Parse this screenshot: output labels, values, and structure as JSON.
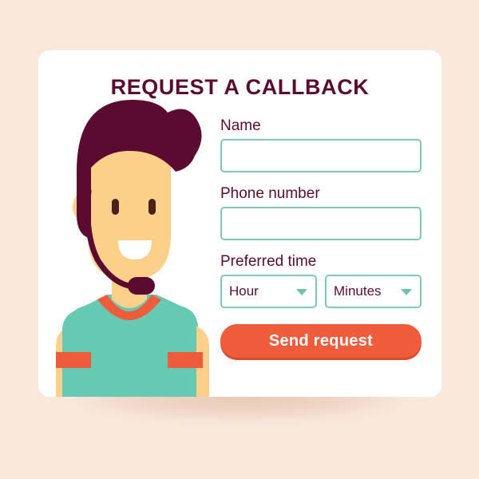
{
  "theme": {
    "background": "#FAE8DD",
    "card": "#FFFFFF",
    "accent_maroon": "#5C0B30",
    "accent_mint": "#7CCAB4",
    "accent_orange": "#EF5C3C",
    "skin": "#FAD08A",
    "shirt": "#66C9B1"
  },
  "card": {
    "title": "REQUEST A CALLBACK"
  },
  "form": {
    "fields": [
      {
        "label": "Name",
        "value": "",
        "placeholder": ""
      },
      {
        "label": "Phone number",
        "value": "",
        "placeholder": ""
      }
    ],
    "preferred_time": {
      "label": "Preferred time",
      "hour_select": {
        "value": "Hour",
        "icon": "chevron-down-icon"
      },
      "minutes_select": {
        "value": "Minutes",
        "icon": "chevron-down-icon"
      }
    },
    "submit_label": "Send request"
  },
  "illustration": {
    "name": "call-center-operator-with-headset",
    "parts": [
      "hair",
      "face",
      "ear",
      "eyes",
      "smile",
      "headset-band",
      "headset-mic",
      "t-shirt",
      "collar-trim",
      "sleeve-cuffs"
    ]
  }
}
